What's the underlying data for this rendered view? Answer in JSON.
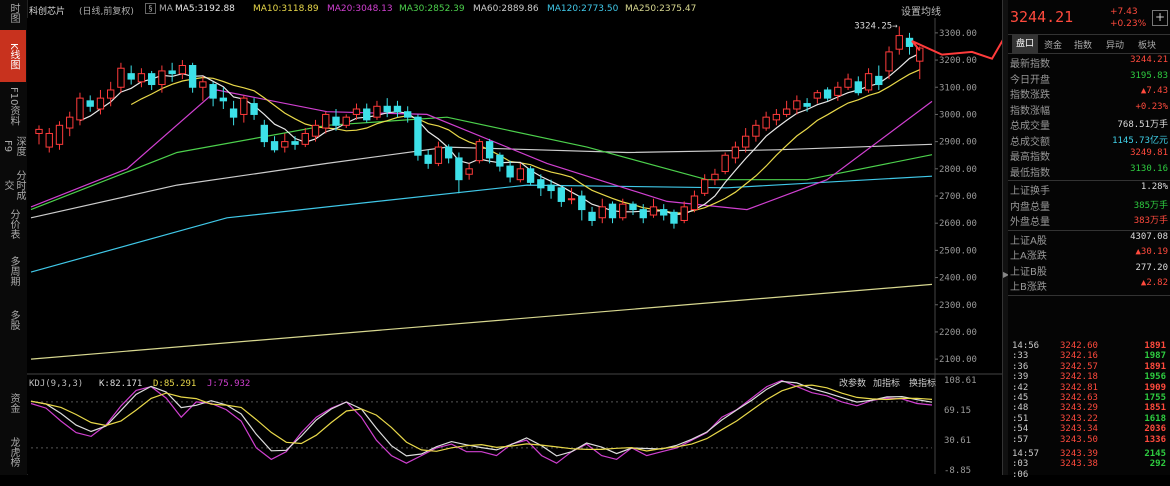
{
  "left_tabs": [
    {
      "label": "时图",
      "active": false
    },
    {
      "label": "K线图",
      "active": true
    },
    {
      "label": "F10资料",
      "active": false
    },
    {
      "label": "深度F9",
      "active": false
    },
    {
      "label": "分时成交",
      "active": false
    },
    {
      "label": "分价表",
      "active": false
    },
    {
      "label": "多周期",
      "active": false
    },
    {
      "label": "多股",
      "active": false
    },
    {
      "label": "资金",
      "active": false
    },
    {
      "label": "龙虎榜",
      "active": false
    }
  ],
  "topbar": {
    "name": "科创芯片",
    "period": "(日线,前复权)",
    "ma_label": "MA",
    "ma": [
      {
        "text": "MA5:3192.88",
        "color": "#e8e8e8"
      },
      {
        "text": "MA10:3118.89",
        "color": "#e8d84a"
      },
      {
        "text": "MA20:3048.13",
        "color": "#d040d0"
      },
      {
        "text": "MA30:2852.39",
        "color": "#4cd04c"
      },
      {
        "text": "MA60:2889.86",
        "color": "#cccccc"
      },
      {
        "text": "MA120:2773.50",
        "color": "#40c8e8"
      },
      {
        "text": "MA250:2375.47",
        "color": "#d8d890"
      }
    ],
    "settings": "设置均线"
  },
  "kdj": {
    "label": "KDJ(9,3,3)",
    "k": "K:82.171",
    "d": "D:85.291",
    "j": "J:75.932",
    "actions": [
      "改参数",
      "加指标",
      "换指标"
    ],
    "axis": [
      "108.61",
      "69.15",
      "30.61",
      "-8.85"
    ]
  },
  "price_axis": [
    "3300.00",
    "3200.00",
    "3100.00",
    "3000.00",
    "2900.00",
    "2800.00",
    "2700.00",
    "2600.00",
    "2500.00",
    "2400.00",
    "2300.00",
    "2200.00",
    "2100.00"
  ],
  "peak_label": "3324.25→",
  "header": {
    "price": "3244.21",
    "change": "+7.43",
    "pct": "+0.23%"
  },
  "right_tabs": [
    "盘口",
    "资金",
    "指数",
    "异动",
    "板块"
  ],
  "stats": [
    {
      "k": "最新指数",
      "v": "3244.21",
      "c": "red"
    },
    {
      "k": "今日开盘",
      "v": "3195.83",
      "c": "green"
    },
    {
      "k": "指数涨跌",
      "v": "▲7.43",
      "c": "red"
    },
    {
      "k": "指数涨幅",
      "v": "+0.23%",
      "c": "red"
    },
    {
      "k": "总成交量",
      "v": "768.51万手",
      "c": "white"
    },
    {
      "k": "总成交额",
      "v": "1145.73亿元",
      "c": "cyan"
    },
    {
      "k": "最高指数",
      "v": "3249.81",
      "c": "red"
    },
    {
      "k": "最低指数",
      "v": "3130.16",
      "c": "green"
    }
  ],
  "stats2": [
    {
      "k": "上证换手",
      "v": "1.28%",
      "c": "white"
    },
    {
      "k": "内盘总量",
      "v": "385万手",
      "c": "green"
    },
    {
      "k": "外盘总量",
      "v": "383万手",
      "c": "red"
    }
  ],
  "stats3": [
    {
      "k": "上证A股",
      "v": "4307.08",
      "c": "white"
    },
    {
      "k": "上A涨跌",
      "v": "▲30.19",
      "c": "red"
    },
    {
      "k": "上证B股",
      "v": "277.20",
      "c": "white"
    },
    {
      "k": "上B涨跌",
      "v": "▲2.82",
      "c": "red"
    }
  ],
  "ticks": [
    {
      "t": "14:56",
      "p": "3242.60",
      "v": "1891",
      "c": "red"
    },
    {
      "t": ":33",
      "p": "3242.16",
      "v": "1987",
      "c": "green"
    },
    {
      "t": ":36",
      "p": "3242.57",
      "v": "1891",
      "c": "red"
    },
    {
      "t": ":39",
      "p": "3242.18",
      "v": "1956",
      "c": "green"
    },
    {
      "t": ":42",
      "p": "3242.81",
      "v": "1909",
      "c": "red"
    },
    {
      "t": ":45",
      "p": "3242.63",
      "v": "1755",
      "c": "green"
    },
    {
      "t": ":48",
      "p": "3243.29",
      "v": "1851",
      "c": "red"
    },
    {
      "t": ":51",
      "p": "3243.22",
      "v": "1618",
      "c": "green"
    },
    {
      "t": ":54",
      "p": "3243.34",
      "v": "2036",
      "c": "red"
    },
    {
      "t": ":57",
      "p": "3243.50",
      "v": "1336",
      "c": "red"
    },
    {
      "t": "14:57",
      "p": "3243.39",
      "v": "2145",
      "c": "green"
    },
    {
      "t": ":03",
      "p": "3243.38",
      "v": "292",
      "c": "green"
    },
    {
      "t": ":06",
      "p": "",
      "v": "",
      "c": "red"
    }
  ],
  "colors": {
    "up": "#ff3b3b",
    "down": "#3de0e8",
    "ma5": "#e8e8e8",
    "ma10": "#e8d84a",
    "ma20": "#d040d0",
    "ma30": "#4cd04c",
    "ma60": "#cccccc",
    "ma120": "#40c8e8",
    "ma250": "#d8d890"
  },
  "chart_data": {
    "type": "candlestick",
    "candles": [
      [
        2930,
        2945,
        2890,
        2960
      ],
      [
        2880,
        2930,
        2860,
        2950
      ],
      [
        2890,
        2960,
        2870,
        2975
      ],
      [
        2950,
        2990,
        2920,
        3010
      ],
      [
        2980,
        3060,
        2960,
        3080
      ],
      [
        3050,
        3030,
        3010,
        3070
      ],
      [
        3020,
        3060,
        3000,
        3090
      ],
      [
        3060,
        3090,
        3030,
        3120
      ],
      [
        3100,
        3170,
        3080,
        3190
      ],
      [
        3150,
        3130,
        3110,
        3180
      ],
      [
        3120,
        3150,
        3100,
        3170
      ],
      [
        3150,
        3110,
        3090,
        3160
      ],
      [
        3110,
        3160,
        3080,
        3180
      ],
      [
        3160,
        3150,
        3120,
        3190
      ],
      [
        3150,
        3180,
        3130,
        3200
      ],
      [
        3180,
        3100,
        3080,
        3190
      ],
      [
        3100,
        3120,
        3050,
        3140
      ],
      [
        3110,
        3060,
        3030,
        3120
      ],
      [
        3060,
        3050,
        3020,
        3100
      ],
      [
        3020,
        2990,
        2960,
        3050
      ],
      [
        3000,
        3060,
        2970,
        3070
      ],
      [
        3040,
        3000,
        2980,
        3060
      ],
      [
        2960,
        2900,
        2880,
        2980
      ],
      [
        2900,
        2870,
        2860,
        2920
      ],
      [
        2880,
        2900,
        2860,
        2930
      ],
      [
        2900,
        2890,
        2870,
        2920
      ],
      [
        2890,
        2930,
        2880,
        2950
      ],
      [
        2920,
        2960,
        2900,
        2980
      ],
      [
        2950,
        3000,
        2930,
        3010
      ],
      [
        2990,
        2960,
        2940,
        3020
      ],
      [
        2960,
        2990,
        2950,
        3000
      ],
      [
        3000,
        3020,
        2980,
        3040
      ],
      [
        3020,
        2980,
        2970,
        3040
      ],
      [
        2990,
        3030,
        2980,
        3050
      ],
      [
        3030,
        3010,
        2990,
        3060
      ],
      [
        3030,
        3010,
        2990,
        3050
      ],
      [
        3010,
        2990,
        2970,
        3030
      ],
      [
        2990,
        2850,
        2830,
        3000
      ],
      [
        2850,
        2820,
        2800,
        2870
      ],
      [
        2820,
        2880,
        2810,
        2900
      ],
      [
        2880,
        2840,
        2820,
        2890
      ],
      [
        2840,
        2760,
        2710,
        2860
      ],
      [
        2780,
        2800,
        2760,
        2820
      ],
      [
        2830,
        2900,
        2820,
        2910
      ],
      [
        2900,
        2840,
        2820,
        2910
      ],
      [
        2850,
        2810,
        2790,
        2860
      ],
      [
        2810,
        2770,
        2750,
        2830
      ],
      [
        2760,
        2800,
        2750,
        2820
      ],
      [
        2800,
        2750,
        2740,
        2810
      ],
      [
        2760,
        2730,
        2700,
        2780
      ],
      [
        2740,
        2720,
        2690,
        2760
      ],
      [
        2730,
        2680,
        2660,
        2740
      ],
      [
        2690,
        2690,
        2670,
        2730
      ],
      [
        2700,
        2650,
        2610,
        2720
      ],
      [
        2640,
        2610,
        2590,
        2660
      ],
      [
        2620,
        2660,
        2600,
        2690
      ],
      [
        2670,
        2620,
        2600,
        2680
      ],
      [
        2620,
        2670,
        2610,
        2690
      ],
      [
        2670,
        2650,
        2630,
        2680
      ],
      [
        2650,
        2620,
        2600,
        2670
      ],
      [
        2630,
        2660,
        2620,
        2690
      ],
      [
        2650,
        2630,
        2610,
        2670
      ],
      [
        2640,
        2600,
        2580,
        2650
      ],
      [
        2610,
        2660,
        2600,
        2680
      ],
      [
        2650,
        2700,
        2640,
        2720
      ],
      [
        2710,
        2760,
        2700,
        2780
      ],
      [
        2760,
        2780,
        2740,
        2800
      ],
      [
        2790,
        2850,
        2780,
        2860
      ],
      [
        2840,
        2880,
        2820,
        2900
      ],
      [
        2880,
        2920,
        2860,
        2950
      ],
      [
        2920,
        2960,
        2900,
        2980
      ],
      [
        2950,
        2990,
        2940,
        3010
      ],
      [
        2980,
        3000,
        2960,
        3020
      ],
      [
        3000,
        3020,
        2990,
        3050
      ],
      [
        3020,
        3050,
        3000,
        3070
      ],
      [
        3040,
        3030,
        3010,
        3060
      ],
      [
        3060,
        3080,
        3040,
        3090
      ],
      [
        3090,
        3060,
        3050,
        3100
      ],
      [
        3070,
        3100,
        3050,
        3120
      ],
      [
        3100,
        3130,
        3090,
        3150
      ],
      [
        3120,
        3080,
        3070,
        3140
      ],
      [
        3090,
        3150,
        3080,
        3170
      ],
      [
        3140,
        3110,
        3090,
        3180
      ],
      [
        3160,
        3230,
        3130,
        3250
      ],
      [
        3240,
        3290,
        3220,
        3324
      ],
      [
        3280,
        3250,
        3220,
        3300
      ],
      [
        3196,
        3244,
        3130,
        3250
      ]
    ],
    "ylim": [
      2060,
      3340
    ]
  }
}
